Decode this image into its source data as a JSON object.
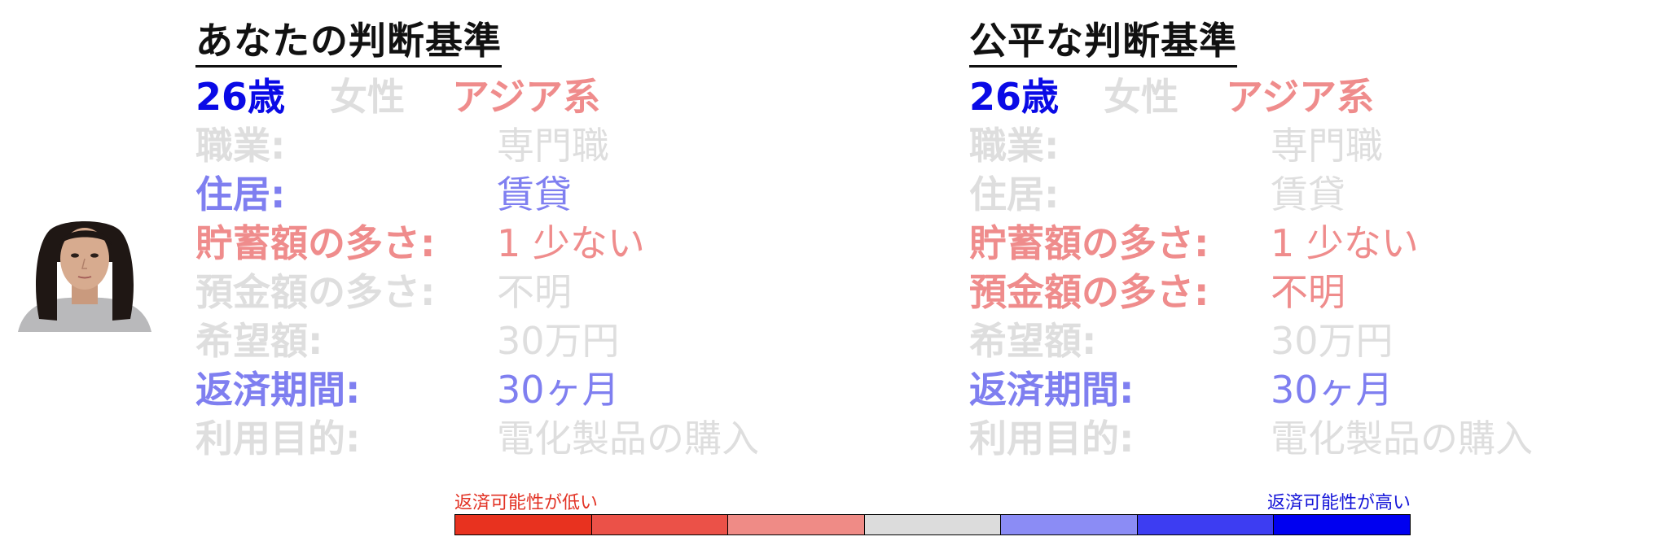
{
  "colors": {
    "blue": "#0a0ae6",
    "light_blue": "#7f7ff0",
    "gray": "#dedede",
    "red": "#e64545",
    "light_red": "#ef8c8c",
    "scale": [
      "#e8321f",
      "#eb5148",
      "#ef8b86",
      "#dcdcdc",
      "#8b8cf5",
      "#3d3df2",
      "#0000f0"
    ]
  },
  "left": {
    "title": "あなたの判断基準",
    "demographics": {
      "age": {
        "text": "26歳",
        "color": "blue"
      },
      "gender": {
        "text": "女性",
        "color": "gray"
      },
      "ethnicity": {
        "text": "アジア系",
        "color": "light_red"
      }
    },
    "rows": [
      {
        "label": "職業:",
        "value": "専門職",
        "color": "gray"
      },
      {
        "label": "住居:",
        "value": "賃貸",
        "color": "light_blue"
      },
      {
        "label": "貯蓄額の多さ:",
        "value": "1 少ない",
        "color": "light_red"
      },
      {
        "label": "預金額の多さ:",
        "value": "不明",
        "color": "gray"
      },
      {
        "label": "希望額:",
        "value": "30万円",
        "color": "gray"
      },
      {
        "label": "返済期間:",
        "value": "30ヶ月",
        "color": "light_blue"
      },
      {
        "label": "利用目的:",
        "value": "電化製品の購入",
        "color": "gray"
      }
    ]
  },
  "right": {
    "title": "公平な判断基準",
    "demographics": {
      "age": {
        "text": "26歳",
        "color": "blue"
      },
      "gender": {
        "text": "女性",
        "color": "gray"
      },
      "ethnicity": {
        "text": "アジア系",
        "color": "light_red"
      }
    },
    "rows": [
      {
        "label": "職業:",
        "value": "専門職",
        "color": "gray"
      },
      {
        "label": "住居:",
        "value": "賃貸",
        "color": "gray"
      },
      {
        "label": "貯蓄額の多さ:",
        "value": "1 少ない",
        "color": "light_red"
      },
      {
        "label": "預金額の多さ:",
        "value": "不明",
        "color": "light_red"
      },
      {
        "label": "希望額:",
        "value": "30万円",
        "color": "gray"
      },
      {
        "label": "返済期間:",
        "value": "30ヶ月",
        "color": "light_blue"
      },
      {
        "label": "利用目的:",
        "value": "電化製品の購入",
        "color": "gray"
      }
    ]
  },
  "legend": {
    "low_label": "返済可能性が低い",
    "high_label": "返済可能性が高い"
  }
}
